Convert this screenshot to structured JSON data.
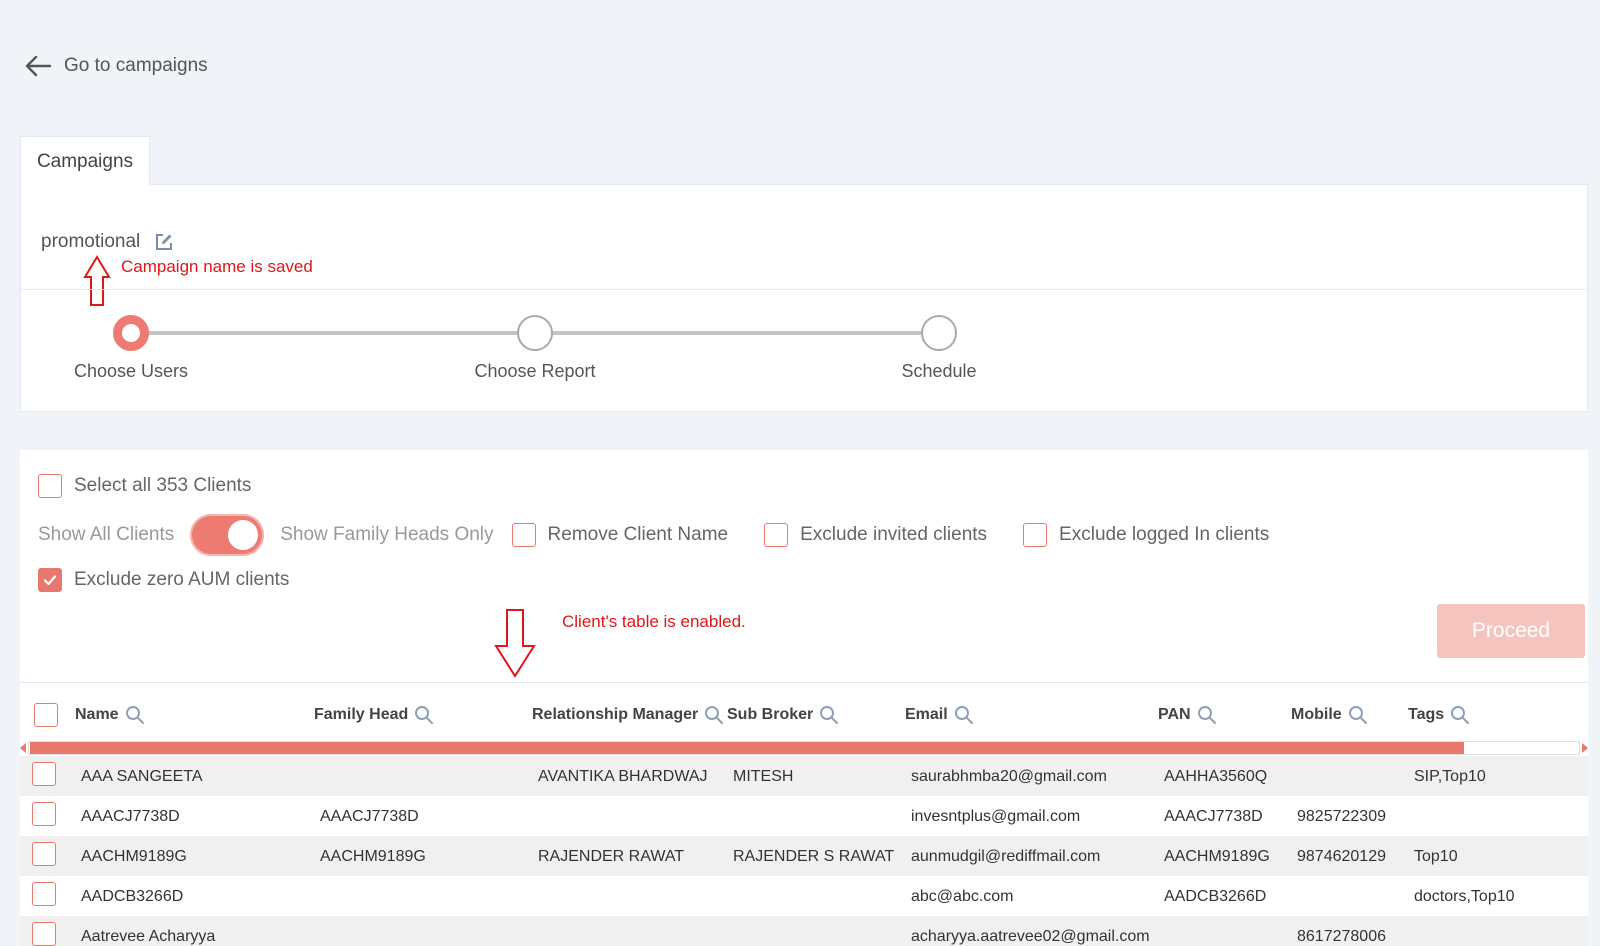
{
  "nav": {
    "back_label": "Go to campaigns"
  },
  "tabs": [
    {
      "label": "Campaigns"
    }
  ],
  "campaign": {
    "name": "promotional",
    "annotation": "Campaign name is saved",
    "steps": [
      {
        "label": "Choose Users",
        "active": true
      },
      {
        "label": "Choose Report",
        "active": false
      },
      {
        "label": "Schedule",
        "active": false
      }
    ]
  },
  "users": {
    "select_all_label": "Select all 353 Clients",
    "toggle_left_label": "Show All Clients",
    "toggle_right_label": "Show Family Heads Only",
    "toggle_on": true,
    "remove_client_name_label": "Remove Client Name",
    "exclude_invited_label": "Exclude invited clients",
    "exclude_logged_label": "Exclude logged In clients",
    "exclude_zero_aum_label": "Exclude zero AUM clients",
    "exclude_zero_aum_checked": true,
    "annotation": "Client's table is enabled.",
    "proceed_label": "Proceed"
  },
  "table": {
    "columns": [
      "Name",
      "Family Head",
      "Relationship Manager",
      "Sub Broker",
      "Email",
      "PAN",
      "Mobile",
      "Tags"
    ],
    "rows": [
      [
        "AAA SANGEETA",
        "",
        "AVANTIKA BHARDWAJ",
        "MITESH",
        "saurabhmba20@gmail.com",
        "AAHHA3560Q",
        "",
        "SIP,Top10"
      ],
      [
        "AAACJ7738D",
        "AAACJ7738D",
        "",
        "",
        "invesntplus@gmail.com",
        "AAACJ7738D",
        "9825722309",
        ""
      ],
      [
        "AACHM9189G",
        "AACHM9189G",
        "RAJENDER RAWAT",
        "RAJENDER S RAWAT",
        "aunmudgil@rediffmail.com",
        "AACHM9189G",
        "9874620129",
        "Top10"
      ],
      [
        "AADCB3266D",
        "",
        "",
        "",
        "abc@abc.com",
        "AADCB3266D",
        "",
        "doctors,Top10"
      ],
      [
        "Aatrevee Acharyya",
        "",
        "",
        "",
        "acharyya.aatrevee02@gmail.com",
        "",
        "8617278006",
        ""
      ]
    ]
  },
  "colors": {
    "accent": "#ee7b72",
    "annotation": "#e0161a",
    "proceed_disabled": "#f6c4bf"
  }
}
